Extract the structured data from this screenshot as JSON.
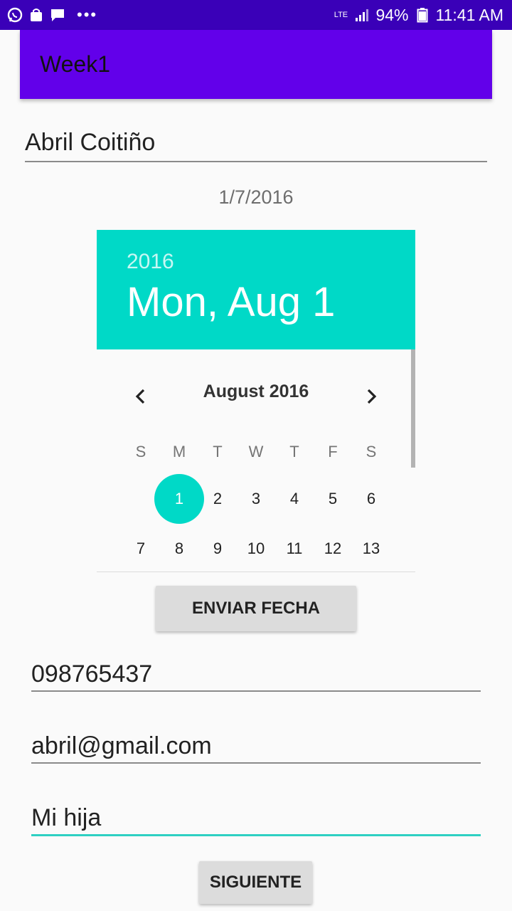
{
  "status_bar": {
    "network": "LTE",
    "battery": "94%",
    "time": "11:41 AM",
    "left_icons": [
      "whatsapp-icon",
      "shopping-bag-icon",
      "message-icon",
      "more-dots-icon"
    ]
  },
  "app_bar": {
    "title": "Week1"
  },
  "form": {
    "name_value": "Abril Coitiño",
    "date_text": "1/7/2016",
    "phone_value": "098765437",
    "email_value": "abril@gmail.com",
    "relation_value": "Mi hija",
    "send_date_label": "ENVIAR FECHA",
    "next_label": "SIGUIENTE"
  },
  "date_picker": {
    "accent_color": "#00d9c7",
    "header_year": "2016",
    "header_date": "Mon, Aug 1",
    "month_label": "August 2016",
    "weekdays": [
      "S",
      "M",
      "T",
      "W",
      "T",
      "F",
      "S"
    ],
    "week1": [
      "",
      "1",
      "2",
      "3",
      "4",
      "5",
      "6"
    ],
    "week2": [
      "7",
      "8",
      "9",
      "10",
      "11",
      "12",
      "13"
    ],
    "selected_day": "1"
  },
  "colors": {
    "status_bar": "#3a00b8",
    "app_bar": "#6200ea",
    "picker_header": "#00d9c7",
    "focused_underline": "#2ed0c2"
  }
}
